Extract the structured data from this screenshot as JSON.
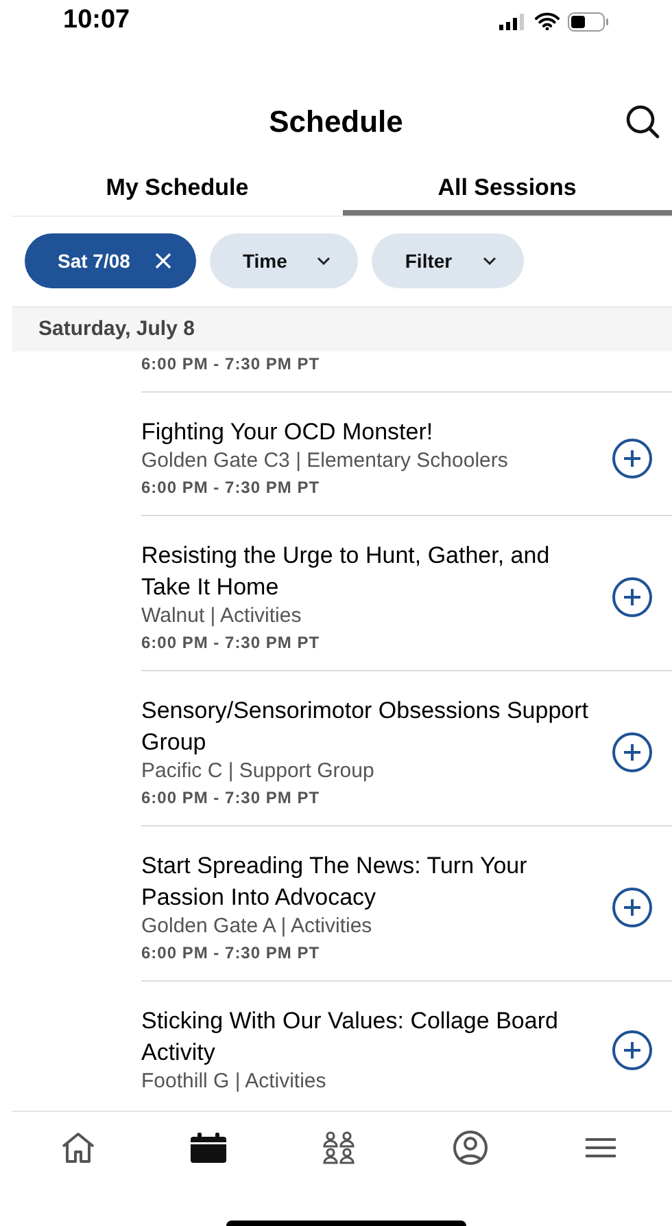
{
  "status_bar": {
    "time": "10:07"
  },
  "header": {
    "title": "Schedule"
  },
  "tabs": [
    {
      "label": "My Schedule",
      "selected": false
    },
    {
      "label": "All Sessions",
      "selected": true
    }
  ],
  "chips": [
    {
      "kind": "active",
      "label": "Sat 7/08"
    },
    {
      "kind": "dropdown",
      "label": "Time"
    },
    {
      "kind": "dropdown",
      "label": "Filter"
    }
  ],
  "date_header": "Saturday, July 8",
  "sessions": [
    {
      "time": "6:00 PM - 7:30 PM PT"
    },
    {
      "title": "Fighting Your OCD Monster!",
      "location": "Golden Gate C3 | Elementary Schoolers",
      "time": "6:00 PM - 7:30 PM PT"
    },
    {
      "title": "Resisting the Urge to Hunt, Gather, and Take It Home",
      "location": "Walnut | Activities",
      "time": "6:00 PM - 7:30 PM PT"
    },
    {
      "title": "Sensory/Sensorimotor Obsessions Support Group",
      "location": "Pacific C | Support Group",
      "time": "6:00 PM - 7:30 PM PT"
    },
    {
      "title": "Start Spreading The News: Turn Your Passion Into Advocacy",
      "location": "Golden Gate A | Activities",
      "time": "6:00 PM - 7:30 PM PT"
    },
    {
      "title": "Sticking With Our Values: Collage Board Activity",
      "location": "Foothill G | Activities"
    }
  ],
  "bottom_nav": [
    {
      "kind": "home",
      "selected": false
    },
    {
      "kind": "calendar",
      "selected": true
    },
    {
      "kind": "people",
      "selected": false
    },
    {
      "kind": "profile",
      "selected": false
    },
    {
      "kind": "menu",
      "selected": false
    }
  ]
}
